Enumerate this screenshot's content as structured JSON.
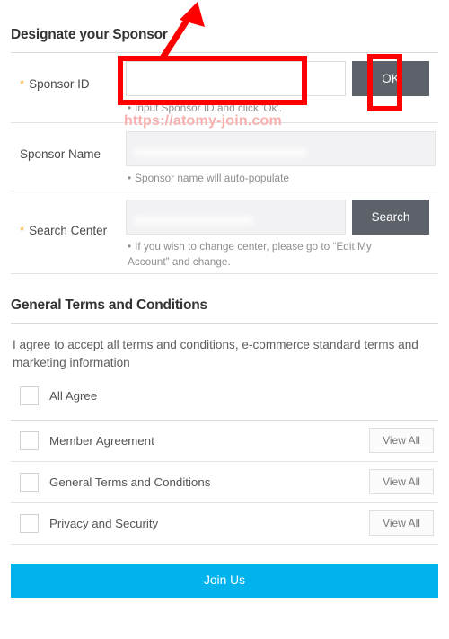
{
  "sponsor_section": {
    "title": "Designate your Sponsor",
    "rows": [
      {
        "label": "Sponsor ID",
        "required": true,
        "required_mark": "*",
        "value": "",
        "placeholder": "",
        "button": "OK",
        "hint": "Input Sponsor ID and click 'Ok'.",
        "hint_bullet": "•"
      },
      {
        "label": "Sponsor Name",
        "required": false,
        "required_mark": "",
        "value": "",
        "placeholder": "",
        "button": "",
        "hint": "Sponsor name will auto-populate",
        "hint_bullet": "•"
      },
      {
        "label": "Search Center",
        "required": true,
        "required_mark": "*",
        "value": "",
        "placeholder": "",
        "button": "Search",
        "hint": "If you wish to change center, please go to “Edit My Account” and change.",
        "hint_bullet": "•"
      }
    ]
  },
  "terms_section": {
    "title": "General Terms and Conditions",
    "intro": "I agree to accept all terms and conditions, e-commerce standard terms and marketing information",
    "all_agree": {
      "label": "All Agree",
      "checked": false
    },
    "items": [
      {
        "label": "Member Agreement",
        "checked": false,
        "button": "View All"
      },
      {
        "label": "General Terms and Conditions",
        "checked": false,
        "button": "View All"
      },
      {
        "label": "Privacy and Security",
        "checked": false,
        "button": "View All"
      }
    ]
  },
  "submit": {
    "label": "Join Us"
  },
  "annotations": {
    "watermark": "https://atomy-join.com",
    "arrow_color": "#ff0000",
    "box_color": "#ff0000"
  },
  "colors": {
    "accent": "#00b3ec",
    "button_gray": "#5c616a",
    "required_orange": "#f5a31a",
    "annotation_red": "#ff0000",
    "watermark_pink": "#f6b0ae"
  }
}
